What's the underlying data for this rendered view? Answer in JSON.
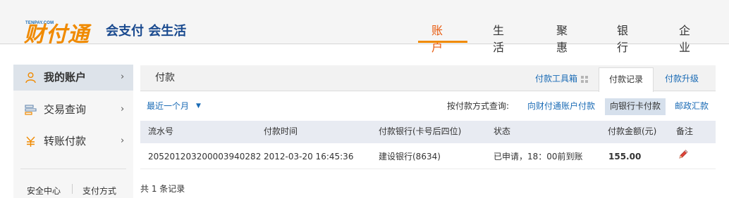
{
  "logo": {
    "small_text": "TENPAY.COM",
    "main_text": "财付通",
    "slogan": "会支付 会生活"
  },
  "nav": {
    "items": [
      "账户",
      "生活",
      "聚惠",
      "银行",
      "企业"
    ],
    "active": "账户"
  },
  "sidebar": {
    "items": [
      {
        "label": "我的账户",
        "icon": "user-icon"
      },
      {
        "label": "交易查询",
        "icon": "list-icon"
      },
      {
        "label": "转账付款",
        "icon": "yen-icon"
      }
    ],
    "footer": [
      "安全中心",
      "支付方式"
    ]
  },
  "panel": {
    "title": "付款",
    "tabs": [
      "付款工具箱",
      "付款记录",
      "付款升级"
    ],
    "active_tab": "付款记录"
  },
  "filter": {
    "period": "最近一个月",
    "query_label": "按付款方式查询:",
    "methods": [
      "向财付通账户付款",
      "向银行卡付款",
      "邮政汇款"
    ],
    "selected_method": "向银行卡付款"
  },
  "table": {
    "headers": [
      "流水号",
      "付款时间",
      "付款银行(卡号后四位)",
      "状态",
      "付款金额(元)",
      "备注"
    ],
    "rows": [
      [
        "20520120320000394028 2",
        "2012-03-20 16:45:36",
        "建设银行(8634)",
        "已申请，18：00前到账",
        "155.00",
        "edit"
      ]
    ],
    "count_text": "共 1 条记录"
  },
  "colors": {
    "accent": "#f08a00",
    "link": "#1a6bb5",
    "brand_blue": "#1a4a8f"
  }
}
